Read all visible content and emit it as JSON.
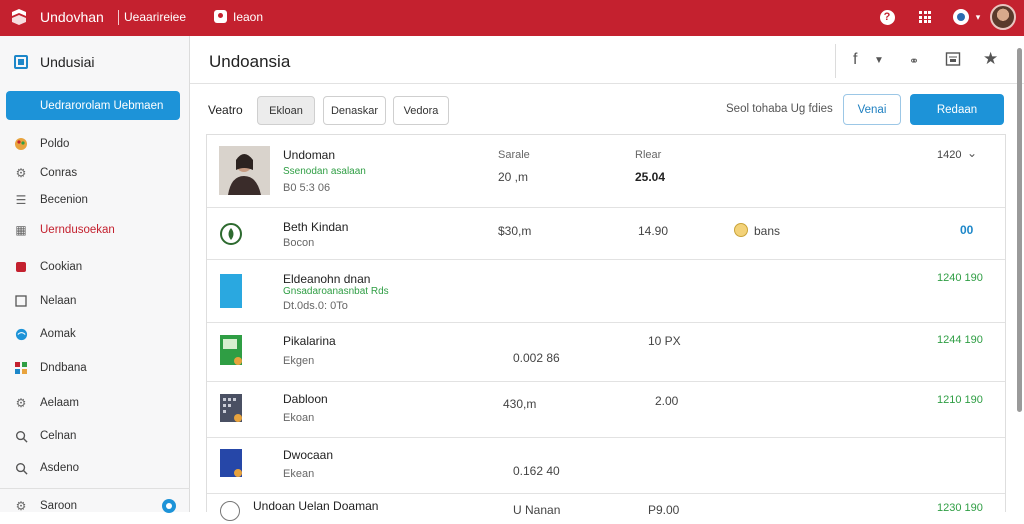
{
  "topbar": {
    "app_title": "Undovhan",
    "sub_title": "Ueaarireiee",
    "link": "Ieaon",
    "icons": [
      "help-icon",
      "apps-grid-icon",
      "notification-icon",
      "user-avatar"
    ]
  },
  "sidebar": {
    "header": "Undusiai",
    "active_item": "Uedrarorolam Uebmaen",
    "items": [
      {
        "label": "Poldo",
        "icon": "palette-icon"
      },
      {
        "label": "Conras",
        "icon": "settings-icon"
      },
      {
        "label": "Becenion",
        "icon": "list-icon"
      },
      {
        "label": "Uerndusoekan",
        "icon": "table-icon",
        "highlight": true
      },
      {
        "label": "Cookian",
        "icon": "bookmark-icon"
      },
      {
        "label": "Nelaan",
        "icon": "square-icon"
      },
      {
        "label": "Aomak",
        "icon": "globe-icon"
      },
      {
        "label": "Dndbana",
        "icon": "apps-icon"
      },
      {
        "label": "Aelaam",
        "icon": "gear-icon"
      },
      {
        "label": "Celnan",
        "icon": "search-icon"
      },
      {
        "label": "Asdeno",
        "icon": "search-icon"
      },
      {
        "label": "Saroon",
        "icon": "settings-icon"
      }
    ]
  },
  "main": {
    "title": "Undoansia",
    "head_icons": [
      "f",
      "chevron-down-icon",
      "link-icon",
      "calendar-icon",
      "star-icon"
    ],
    "toolbar": {
      "label": "Veatro",
      "chips": [
        "Ekloan",
        "Denaskar",
        "Vedora"
      ],
      "right_label": "Seol tohaba Ug fdies",
      "outline_button": "Venai",
      "primary_button": "Redaan"
    },
    "rows": [
      {
        "name": "Undoman",
        "green": "Ssenodan asalaan",
        "sub": "B0 5:3 06",
        "c1_top": "Sarale",
        "c1": "20 ,m",
        "c2_top": "Rlear",
        "c2": "25.04",
        "right": "1420"
      },
      {
        "name": "Beth Kindan",
        "sub": "Bocon",
        "c1": "$30,m",
        "c2": "14.90",
        "c3": "bans",
        "right": "00"
      },
      {
        "name": "Eldeanohn dnan",
        "green": "Gnsadaroanasnbat Rds",
        "sub": "Dt.0ds.0: 0To",
        "right": "1240 190"
      },
      {
        "name": "Pikalarina",
        "sub": "Ekgen",
        "c1": "0.002 86",
        "c2": "10 PX",
        "right": "1244 190"
      },
      {
        "name": "Dabloon",
        "sub": "Ekoan",
        "c1": "430,m",
        "c2": "2.00",
        "right": "1210 190"
      },
      {
        "name": "Dwocaan",
        "sub": "Ekean",
        "c1": "0.162 40",
        "right": ""
      },
      {
        "name": "Undoan Uelan Doaman",
        "sub": "",
        "c1": "U Nanan",
        "c2": "P9.00",
        "right": "1230 190"
      }
    ]
  }
}
